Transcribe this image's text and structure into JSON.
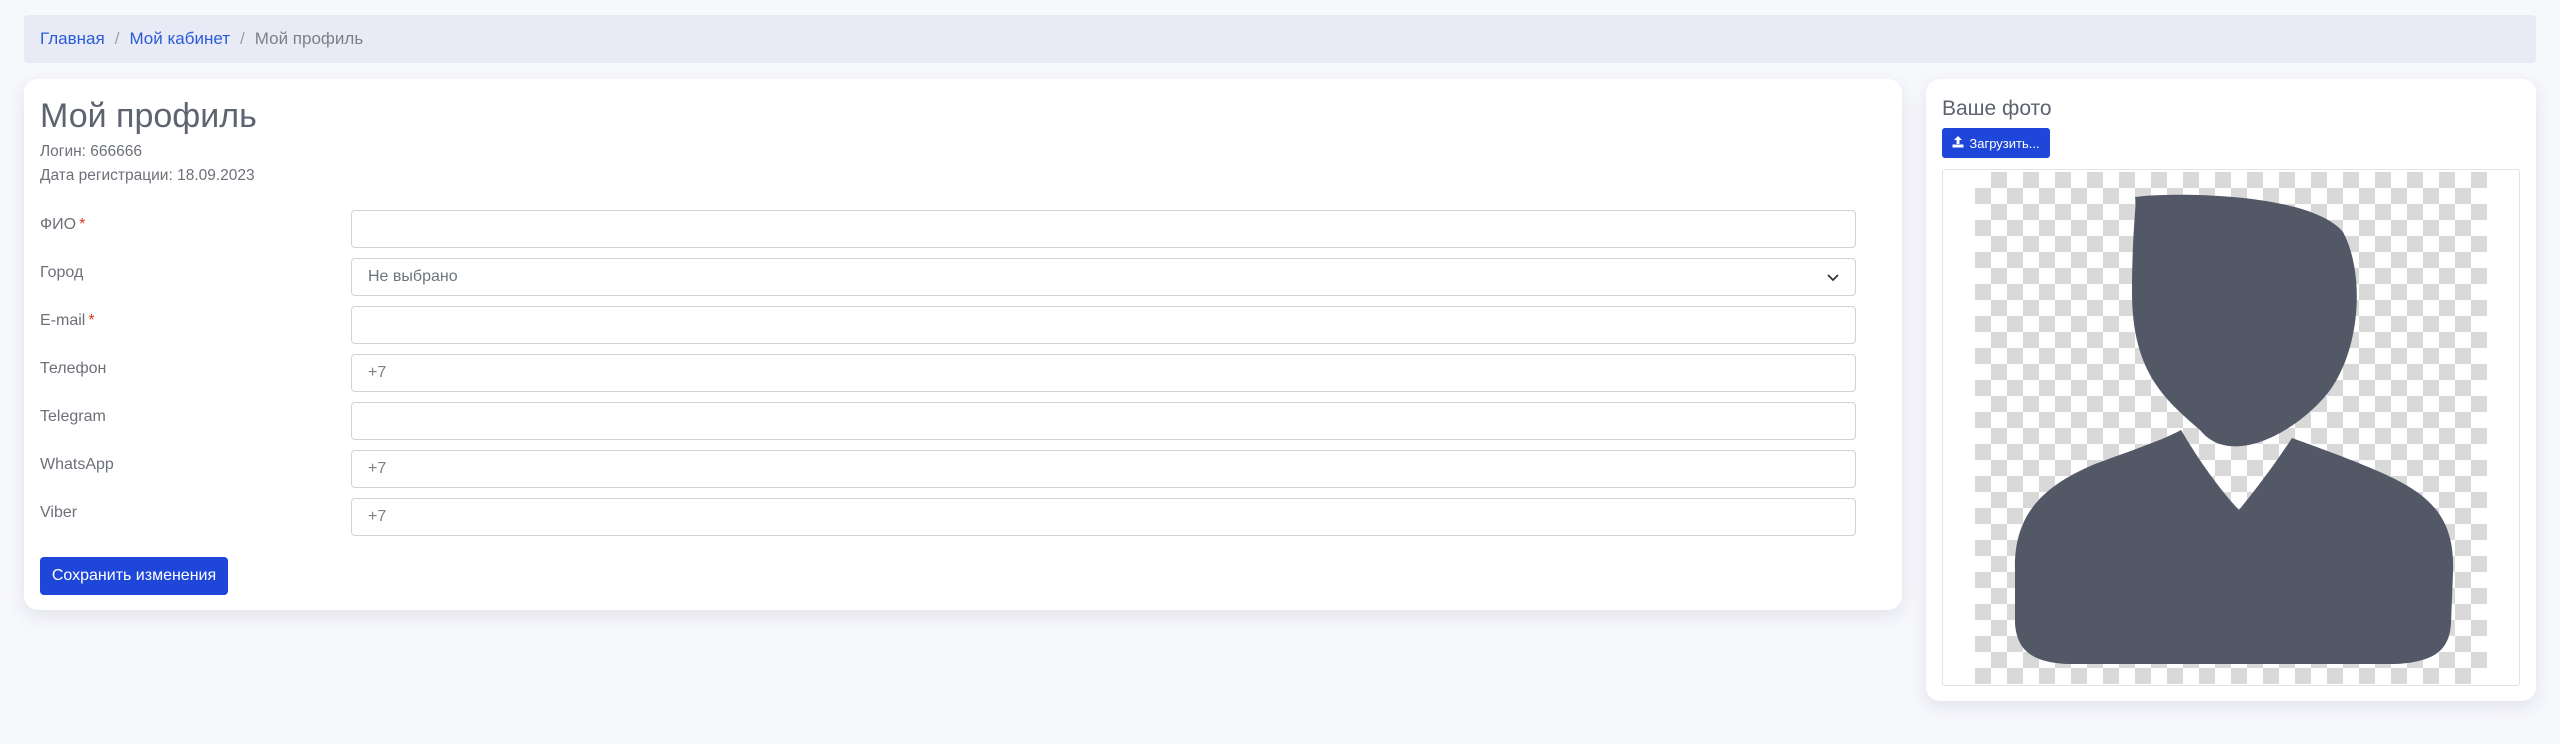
{
  "breadcrumb": {
    "home": "Главная",
    "cabinet": "Мой кабинет",
    "current": "Мой профиль",
    "separator": "/"
  },
  "profile": {
    "title": "Мой профиль",
    "login": "Логин: 666666",
    "registered": "Дата регистрации: 18.09.2023",
    "required_mark": "*",
    "fields": {
      "fio": {
        "label": "ФИО",
        "value": "",
        "placeholder": ""
      },
      "city": {
        "label": "Город",
        "value": "Не выбрано"
      },
      "email": {
        "label": "E-mail",
        "value": "",
        "placeholder": ""
      },
      "phone": {
        "label": "Телефон",
        "placeholder": "+7"
      },
      "telegram": {
        "label": "Telegram",
        "placeholder": ""
      },
      "whatsapp": {
        "label": "WhatsApp",
        "placeholder": "+7"
      },
      "viber": {
        "label": "Viber",
        "placeholder": "+7"
      }
    },
    "save_label": "Сохранить изменения"
  },
  "photo": {
    "title": "Ваше фото",
    "upload_label": "Загрузить...",
    "upload_icon": "upload-icon",
    "avatar": "default-user-silhouette"
  },
  "colors": {
    "primary": "#1e46d8",
    "link": "#2a5bd7",
    "required": "#e0352b",
    "avatar_fill": "#525866",
    "page_bg": "#f7f8fc"
  }
}
